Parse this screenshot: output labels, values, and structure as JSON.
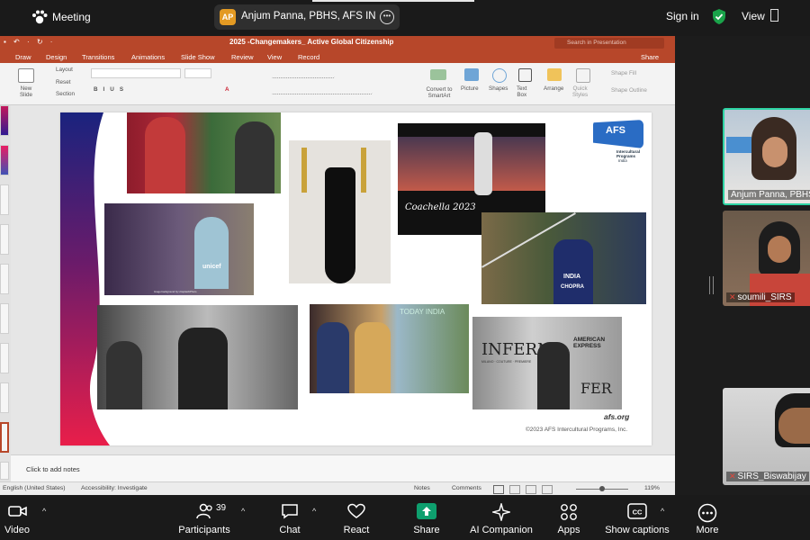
{
  "meeting": {
    "title": "Meeting",
    "speaker_initials": "AP",
    "speaker_name": "Anjum Panna, PBHS, AFS INDIA'",
    "sign_in": "Sign in",
    "view": "View"
  },
  "ppt": {
    "quick_access": "▪ ↶ · ↻ ·",
    "doc_title": "2025 -Changemakers_ Active Global Citizenship",
    "search_placeholder": "Search in Presentation",
    "tabs": [
      "Draw",
      "Design",
      "Transitions",
      "Animations",
      "Slide Show",
      "Review",
      "View",
      "Record"
    ],
    "share": "Share",
    "ribbon": {
      "new_slide": "New\nSlide",
      "layout": "Layout",
      "reset": "Reset",
      "section": "Section",
      "convert": "Convert to\nSmartArt",
      "picture": "Picture",
      "shapes": "Shapes",
      "text_box": "Text\nBox",
      "arrange": "Arrange",
      "quick_styles": "Quick\nStyles",
      "shape_fill": "Shape Fill",
      "shape_outline": "Shape Outline"
    },
    "slide": {
      "coachella_caption": "Coachella 2023",
      "afs_logo_text": "AFS",
      "afs_sub": "Intercultural\nPrograms",
      "afs_india": "India",
      "today_india": "TODAY INDIA",
      "site": "afs.org",
      "copyright": "©2023 AFS Intercultural Programs, Inc.",
      "jersey_text": "INDIA",
      "jersey_name": "CHOPRA",
      "unicef": "unicef",
      "inferno": "INFERNO",
      "amex": "AMERICAN EXPRESS",
      "fer": "FER",
      "unicef_credit": "Image background by Unsplash/Photo",
      "inferno_sub": "MILANO · COUTURE · PREMIERE"
    },
    "notes_placeholder": "Click to add notes",
    "status": {
      "language": "English (United States)",
      "accessibility": "Accessibility: Investigate",
      "notes": "Notes",
      "comments": "Comments",
      "zoom": "119%"
    }
  },
  "participants": [
    {
      "name": "Anjum Panna, PBHS",
      "muted": false,
      "active": true
    },
    {
      "name": "soumili_SIRS",
      "muted": true,
      "active": false
    },
    {
      "name": "SIRS_Biswabijay",
      "muted": true,
      "active": false
    }
  ],
  "toolbar": {
    "video": "Video",
    "participants": "Participants",
    "participant_count": "39",
    "chat": "Chat",
    "react": "React",
    "share": "Share",
    "ai": "AI Companion",
    "apps": "Apps",
    "captions": "Show captions",
    "more": "More"
  },
  "colors": {
    "ppt_accent": "#b7472a",
    "share_green": "#0e9f6e",
    "active_speaker_border": "#2dd3a3",
    "mute_red": "#e2463a"
  }
}
